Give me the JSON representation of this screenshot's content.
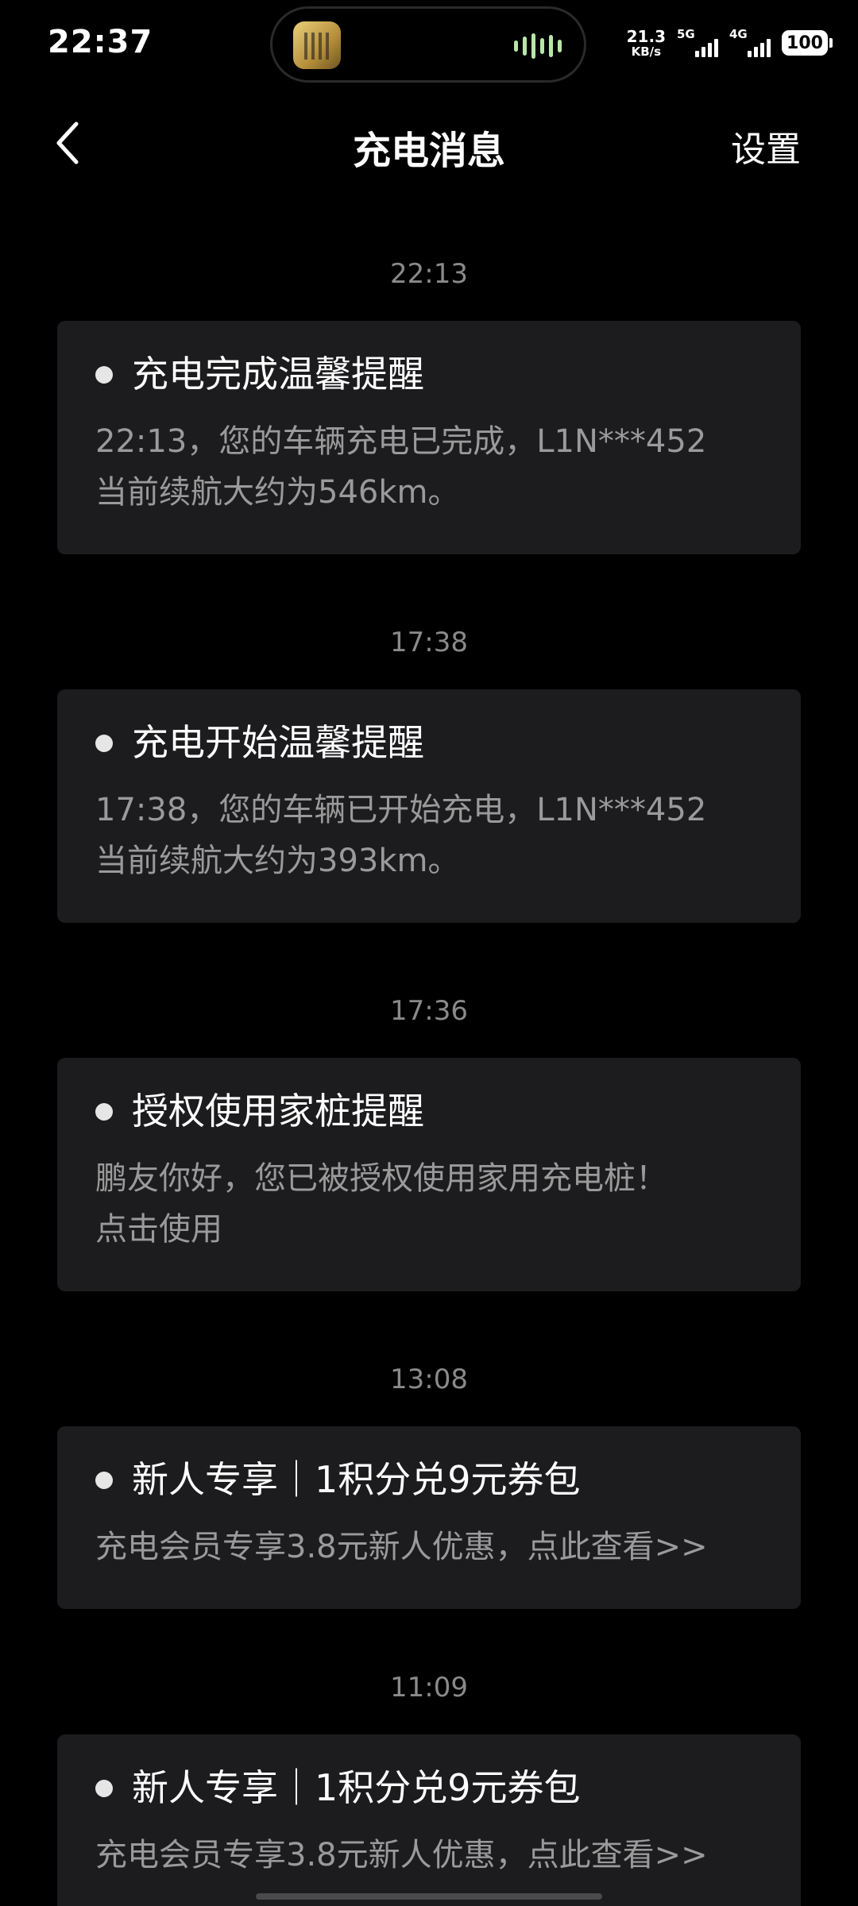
{
  "status_bar": {
    "time": "22:37",
    "net_speed": "21.3",
    "net_speed_unit": "KB/s",
    "signal1_label": "5G",
    "signal2_label": "4G",
    "battery": "100"
  },
  "header": {
    "back_icon": "chevron-left-icon",
    "title": "充电消息",
    "settings_label": "设置"
  },
  "messages": [
    {
      "time": "22:13",
      "title": "充电完成温馨提醒",
      "body": "22:13，您的车辆充电已完成，L1N***452\n当前续航大约为546km。"
    },
    {
      "time": "17:38",
      "title": "充电开始温馨提醒",
      "body": "17:38，您的车辆已开始充电，L1N***452\n当前续航大约为393km。"
    },
    {
      "time": "17:36",
      "title": "授权使用家桩提醒",
      "body": "鹏友你好，您已被授权使用家用充电桩！\n点击使用"
    },
    {
      "time": "13:08",
      "title": "新人专享｜1积分兑9元券包",
      "body": "充电会员专享3.8元新人优惠，点此查看>>"
    },
    {
      "time": "11:09",
      "title": "新人专享｜1积分兑9元券包",
      "body": "充电会员专享3.8元新人优惠，点此查看>>"
    }
  ],
  "colors": {
    "background": "#000000",
    "card": "#1c1c1e",
    "timestamp": "#8a8a8a",
    "body_text": "#9a9a9a"
  }
}
